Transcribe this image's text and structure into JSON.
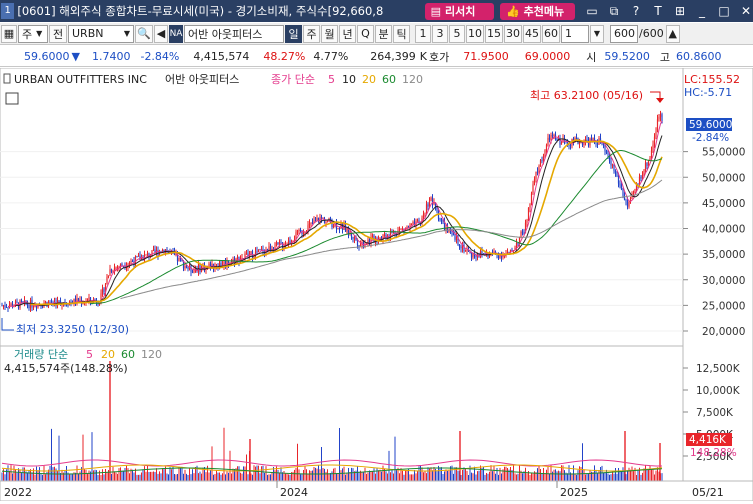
{
  "titlebar": {
    "window_num": "1",
    "title": "[0601] 해외주식 종합차트-무료시세(미국) - 경기소비재, 주식수[92,660,8",
    "research_label": "리서치",
    "recommend_label": "추천메뉴",
    "icons": [
      "window-icon",
      "link-icon",
      "question-icon",
      "pin-icon",
      "tile-icon",
      "minimize-icon",
      "maximize-icon",
      "close-icon"
    ]
  },
  "toolbar": {
    "market": "주",
    "all_label": "전",
    "ticker": "URBN",
    "na_badge": "NA",
    "name": "어반 아웃피터스",
    "periods": [
      "일",
      "주",
      "월",
      "년",
      "Q",
      "분",
      "틱"
    ],
    "minutes": [
      "1",
      "3",
      "5",
      "10",
      "15",
      "30",
      "45",
      "60",
      "1"
    ],
    "count": "600",
    "count_total": "/600"
  },
  "infobar": {
    "price": "59.6000",
    "arrow": "▼",
    "change": "1.7400",
    "change_pct": "-2.84%",
    "volume": "4,415,574",
    "vol_ratio": "48.27%",
    "turnover": "4.77%",
    "prev_vol": "264,399",
    "unit_k": "K",
    "quote_label": "호가",
    "bid": "71.9500",
    "ask": "69.0000",
    "open_label": "시",
    "open": "59.5200",
    "high_label": "고",
    "high": "60.8600"
  },
  "price_chart": {
    "company": "URBAN OUTFITTERS INC",
    "company_kr": "어반 아웃피터스",
    "ma_label": "종가 단순",
    "ma_periods": [
      "5",
      "10",
      "20",
      "60",
      "120"
    ],
    "lc": "LC:155.52",
    "hc": "HC:-5.71",
    "max_label": "최고 63.2100 (05/16)",
    "min_label": "최저 23.3250 (12/30)",
    "current_price": "59.6000",
    "current_pct": "-2.84%",
    "y_ticks": [
      "55,0000",
      "50,0000",
      "45,0000",
      "40,0000",
      "35,0000",
      "30,0000",
      "25,0000",
      "20,0000"
    ]
  },
  "volume_chart": {
    "label": "거래량 단순",
    "ma_periods": [
      "5",
      "20",
      "60",
      "120"
    ],
    "value_text": "4,415,574주(148.28%)",
    "y_ticks": [
      "12,500K",
      "10,000K",
      "7,500K",
      "5,000K",
      "2,500K"
    ],
    "current": "4,416K",
    "current_pct": "148.28%"
  },
  "x_axis": {
    "labels": [
      "2022",
      "2024",
      "2025",
      "05/21"
    ]
  },
  "colors": {
    "up": "#e8252a",
    "down": "#2243c9",
    "ma5": "#e43a8c",
    "ma10": "#222222",
    "ma20": "#e5a800",
    "ma60": "#1b8a2f",
    "ma120": "#8a8a8a"
  }
}
